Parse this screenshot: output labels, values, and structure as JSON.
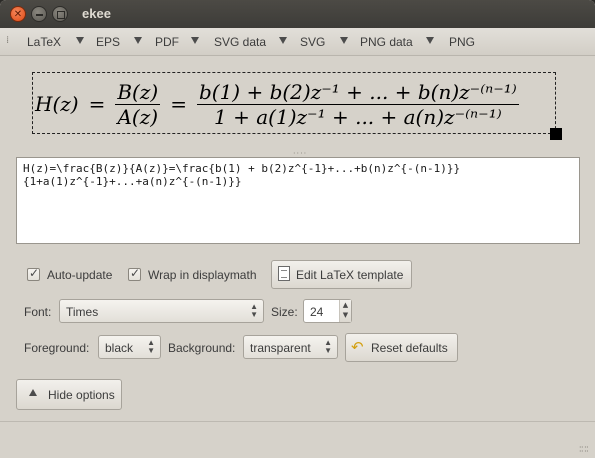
{
  "window": {
    "title": "ekee"
  },
  "toolbar": {
    "items": [
      {
        "label": "LaTeX"
      },
      {
        "label": "EPS"
      },
      {
        "label": "PDF"
      },
      {
        "label": "SVG data"
      },
      {
        "label": "SVG"
      },
      {
        "label": "PNG data"
      },
      {
        "label": "PNG"
      }
    ]
  },
  "formula": {
    "lhs": "H(z)",
    "eq1": "=",
    "frac1_num": "B(z)",
    "frac1_den": "A(z)",
    "eq2": "=",
    "frac2_num": "b(1) + b(2)z⁻¹ + ... + b(n)z⁻⁽ⁿ⁻¹⁾",
    "frac2_den": "1 + a(1)z⁻¹ + ... + a(n)z⁻⁽ⁿ⁻¹⁾"
  },
  "editor": {
    "source": "H(z)=\\frac{B(z)}{A(z)}=\\frac{b(1) + b(2)z^{-1}+...+b(n)z^{-(n-1)}}\n{1+a(1)z^{-1}+...+a(n)z^{-(n-1)}}"
  },
  "options": {
    "auto_update_label": "Auto-update",
    "wrap_label": "Wrap in displaymath",
    "edit_template_label": "Edit LaTeX template",
    "font_label": "Font:",
    "font_value": "Times",
    "size_label": "Size:",
    "size_value": "24",
    "foreground_label": "Foreground:",
    "foreground_value": "black",
    "background_label": "Background:",
    "background_value": "transparent",
    "reset_label": "Reset defaults",
    "hide_options_label": "Hide options"
  },
  "icons": {
    "close": "close-icon",
    "minimize": "minimize-icon",
    "maximize": "maximize-icon",
    "toolbar_arrow": "triangle-down-icon",
    "edit_template": "document-icon",
    "reset": "undo-arrow-icon",
    "hide_options": "triangle-up-icon"
  }
}
